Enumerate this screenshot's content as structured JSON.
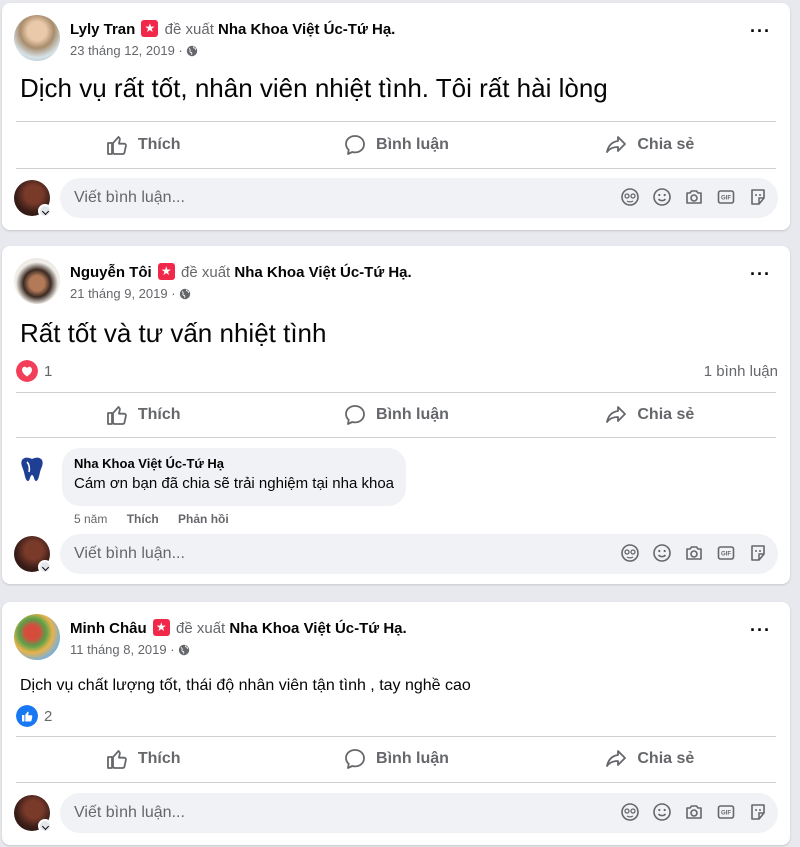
{
  "posts": [
    {
      "author": "Lyly Tran",
      "verb": "đề xuất",
      "page": "Nha Khoa Việt Úc-Tứ Hạ.",
      "date": "23 tháng 12, 2019 ·",
      "text": "Dịch vụ rất tốt, nhân viên nhiệt tình. Tôi rất hài lòng",
      "like_label": "Thích",
      "comment_label": "Bình luận",
      "share_label": "Chia sẻ",
      "comment_placeholder": "Viết bình luận..."
    },
    {
      "author": "Nguyễn Tôi",
      "verb": "đề xuất",
      "page": "Nha Khoa Việt Úc-Tứ Hạ.",
      "date": "21 tháng 9, 2019 ·",
      "text": "Rất tốt và tư vấn nhiệt tình",
      "reaction_type": "love",
      "reaction_count": "1",
      "comment_count": "1 bình luận",
      "like_label": "Thích",
      "comment_label": "Bình luận",
      "share_label": "Chia sẻ",
      "reply": {
        "name": "Nha Khoa Việt Úc-Tứ Hạ",
        "text": "Cám ơn bạn đã chia sẽ trải nghiệm tại nha khoa",
        "age": "5 năm",
        "like": "Thích",
        "respond": "Phản hồi"
      },
      "comment_placeholder": "Viết bình luận..."
    },
    {
      "author": "Minh Châu",
      "verb": "đề xuất",
      "page": "Nha Khoa Việt Úc-Tứ Hạ.",
      "date": "11 tháng 8, 2019 ·",
      "text": "Dịch vụ chất lượng tốt, thái độ nhân viên tận tình , tay nghề cao",
      "reaction_type": "like",
      "reaction_count": "2",
      "like_label": "Thích",
      "comment_label": "Bình luận",
      "share_label": "Chia sẻ",
      "comment_placeholder": "Viết bình luận..."
    }
  ],
  "colors": {
    "background": "#e7e9ee",
    "card": "#ffffff",
    "secondary_text": "#65676b",
    "love": "#f33e58",
    "like": "#1877f2",
    "badge": "#f02849"
  },
  "icons": {
    "composer": [
      "avatar-sticker-icon",
      "emoji-icon",
      "camera-icon",
      "gif-icon",
      "sticker-icon"
    ],
    "actions": [
      "thumbs-up-icon",
      "comment-bubble-icon",
      "share-arrow-icon"
    ]
  }
}
